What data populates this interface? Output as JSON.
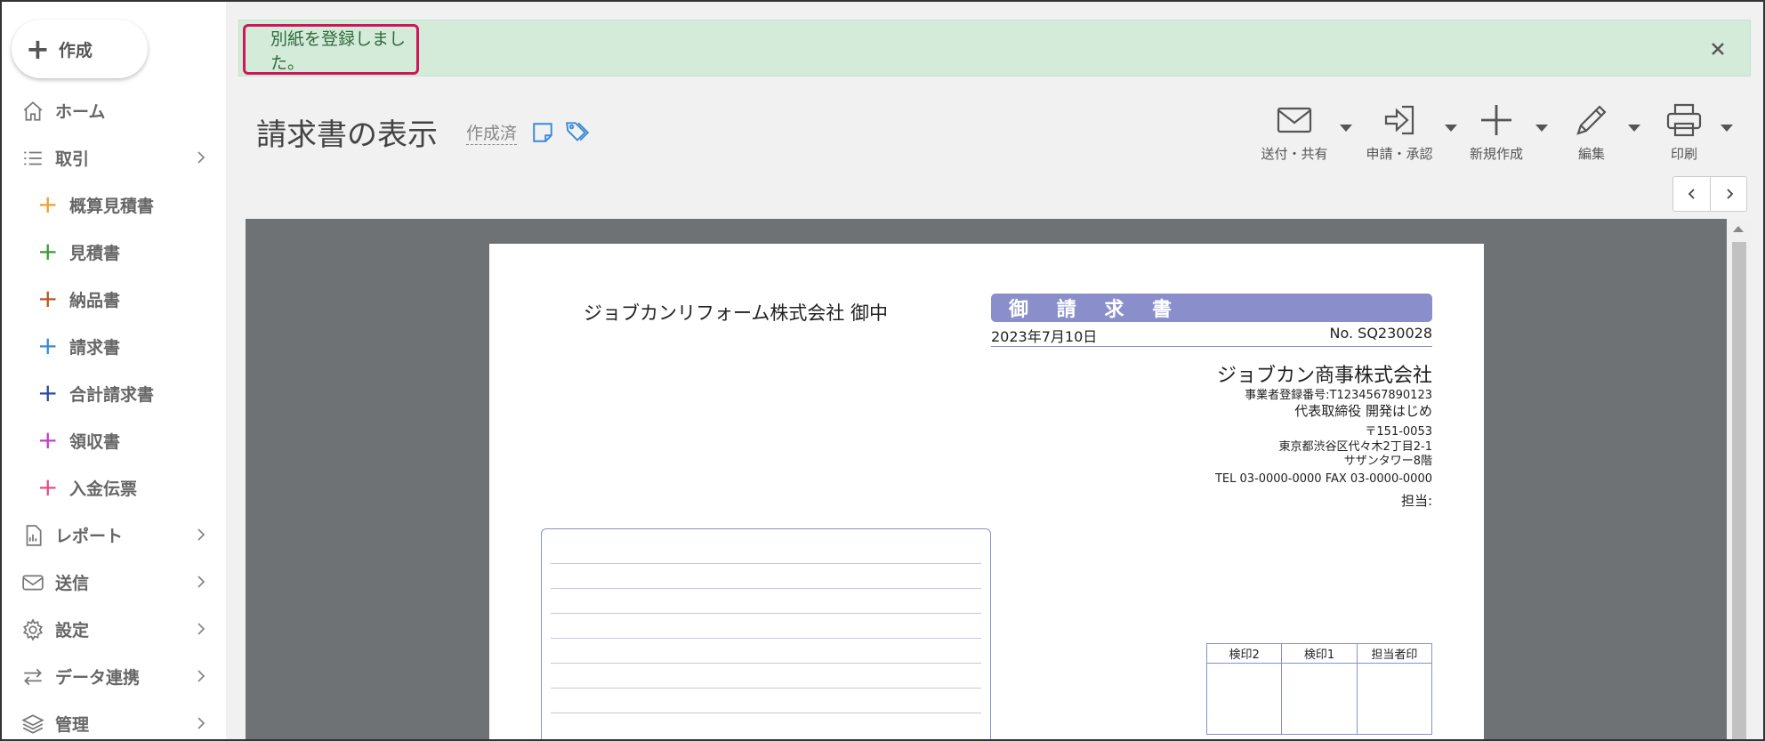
{
  "sidebar": {
    "create_label": "作成",
    "items": [
      {
        "label": "ホーム",
        "icon": "home-icon"
      },
      {
        "label": "取引",
        "icon": "list-icon"
      },
      {
        "label": "レポート",
        "icon": "report-icon"
      },
      {
        "label": "送信",
        "icon": "mail-icon"
      },
      {
        "label": "設定",
        "icon": "gear-icon"
      },
      {
        "label": "データ連携",
        "icon": "sync-icon"
      },
      {
        "label": "管理",
        "icon": "layers-icon"
      }
    ],
    "sub_items": [
      {
        "label": "概算見積書",
        "color": "#f0a030"
      },
      {
        "label": "見積書",
        "color": "#3a9a3a"
      },
      {
        "label": "納品書",
        "color": "#b25a2a"
      },
      {
        "label": "請求書",
        "color": "#3a8ad8"
      },
      {
        "label": "合計請求書",
        "color": "#2a4a9a"
      },
      {
        "label": "領収書",
        "color": "#c040c8"
      },
      {
        "label": "入金伝票",
        "color": "#e0508a"
      }
    ]
  },
  "alert": {
    "message": "別紙を登録しました。"
  },
  "header": {
    "title": "請求書の表示",
    "status": "作成済"
  },
  "toolbar": {
    "send": "送付・共有",
    "apply": "申請・承認",
    "new": "新規作成",
    "edit": "編集",
    "print": "印刷"
  },
  "document": {
    "client": "ジョブカンリフォーム株式会社 御中",
    "title": "御 請 求 書",
    "date": "2023年7月10日",
    "number": "No. SQ230028",
    "company": "ジョブカン商事株式会社",
    "registration": "事業者登録番号:T1234567890123",
    "representative": "代表取締役 開発はじめ",
    "zip": "〒151-0053",
    "address1": "東京都渋谷区代々木2丁目2-1",
    "address2": "サザンタワー8階",
    "tel_fax": "TEL 03-0000-0000 FAX 03-0000-0000",
    "person": "担当:",
    "stamps": [
      "検印2",
      "検印1",
      "担当者印"
    ]
  },
  "colors": {
    "accent": "#8a8fcc",
    "alert_bg": "#d4ebd9",
    "highlight": "#d4145a"
  }
}
